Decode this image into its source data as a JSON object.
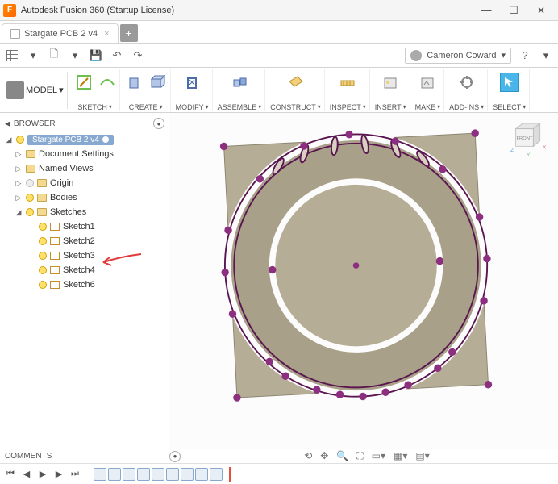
{
  "window": {
    "title": "Autodesk Fusion 360 (Startup License)",
    "app_icon_letter": "F"
  },
  "tabs": {
    "file_name": "Stargate PCB 2 v4",
    "new_tab": "+"
  },
  "qat": {
    "user": "Cameron Coward"
  },
  "ribbon": {
    "model": "MODEL",
    "groups": [
      {
        "id": "sketch",
        "label": "SKETCH"
      },
      {
        "id": "create",
        "label": "CREATE"
      },
      {
        "id": "modify",
        "label": "MODIFY"
      },
      {
        "id": "assemble",
        "label": "ASSEMBLE"
      },
      {
        "id": "construct",
        "label": "CONSTRUCT"
      },
      {
        "id": "inspect",
        "label": "INSPECT"
      },
      {
        "id": "insert",
        "label": "INSERT"
      },
      {
        "id": "make",
        "label": "MAKE"
      },
      {
        "id": "addins",
        "label": "ADD-INS"
      },
      {
        "id": "select",
        "label": "SELECT"
      }
    ]
  },
  "browser": {
    "title": "BROWSER",
    "root": "Stargate PCB 2 v4",
    "nodes": {
      "doc_settings": "Document Settings",
      "named_views": "Named Views",
      "origin": "Origin",
      "bodies": "Bodies",
      "sketches": "Sketches",
      "sk1": "Sketch1",
      "sk2": "Sketch2",
      "sk3": "Sketch3",
      "sk4": "Sketch4",
      "sk6": "Sketch6"
    }
  },
  "viewcube": {
    "front": "FRONT",
    "axes": {
      "x": "X",
      "y": "Y",
      "z": "Z"
    }
  },
  "comments": {
    "label": "COMMENTS"
  },
  "timeline": {
    "item_count": 9
  },
  "colors": {
    "pcb_fill": "#b6ad96",
    "pcb_ring": "#a8a088",
    "sketch_point": "#7b2a6f",
    "sketch_line": "#5a1550",
    "annotation": "#e03a3a",
    "select_btn": "#4ab5e8"
  }
}
